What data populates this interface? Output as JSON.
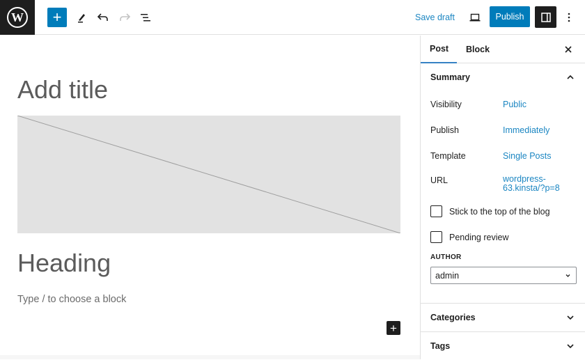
{
  "topbar": {
    "logo": "wordpress-logo",
    "inserter_icon": "plus-icon",
    "tools": [
      {
        "name": "pencil-icon",
        "label": "Tools"
      },
      {
        "name": "undo-icon",
        "label": "Undo"
      },
      {
        "name": "redo-icon",
        "label": "Redo"
      },
      {
        "name": "list-view-icon",
        "label": "Document Overview"
      }
    ],
    "save_draft_label": "Save draft",
    "preview_icon": "desktop-icon",
    "publish_label": "Publish",
    "settings_icon": "sidebar-icon",
    "more_icon": "vertical-ellipsis-icon"
  },
  "editor": {
    "title_placeholder": "Add title",
    "heading": "Heading",
    "paragraph_placeholder": "Type / to choose a block"
  },
  "sidebar": {
    "tabs": [
      {
        "label": "Post",
        "active": true
      },
      {
        "label": "Block",
        "active": false
      }
    ],
    "summary": {
      "title": "Summary",
      "expanded": true,
      "rows": [
        {
          "label": "Visibility",
          "value": "Public"
        },
        {
          "label": "Publish",
          "value": "Immediately"
        },
        {
          "label": "Template",
          "value": "Single Posts"
        },
        {
          "label": "URL",
          "value_line1": "wordpress-",
          "value_line2": "63.kinsta/?p=8"
        }
      ],
      "checkboxes": [
        {
          "label": "Stick to the top of the blog",
          "checked": false
        },
        {
          "label": "Pending review",
          "checked": false
        }
      ],
      "author_label": "AUTHOR",
      "author_value": "admin"
    },
    "panels": [
      {
        "title": "Categories",
        "expanded": false
      },
      {
        "title": "Tags",
        "expanded": false
      }
    ]
  },
  "colors": {
    "accent": "#007cba",
    "link": "#1b86c2",
    "dark": "#1e1e1e"
  }
}
